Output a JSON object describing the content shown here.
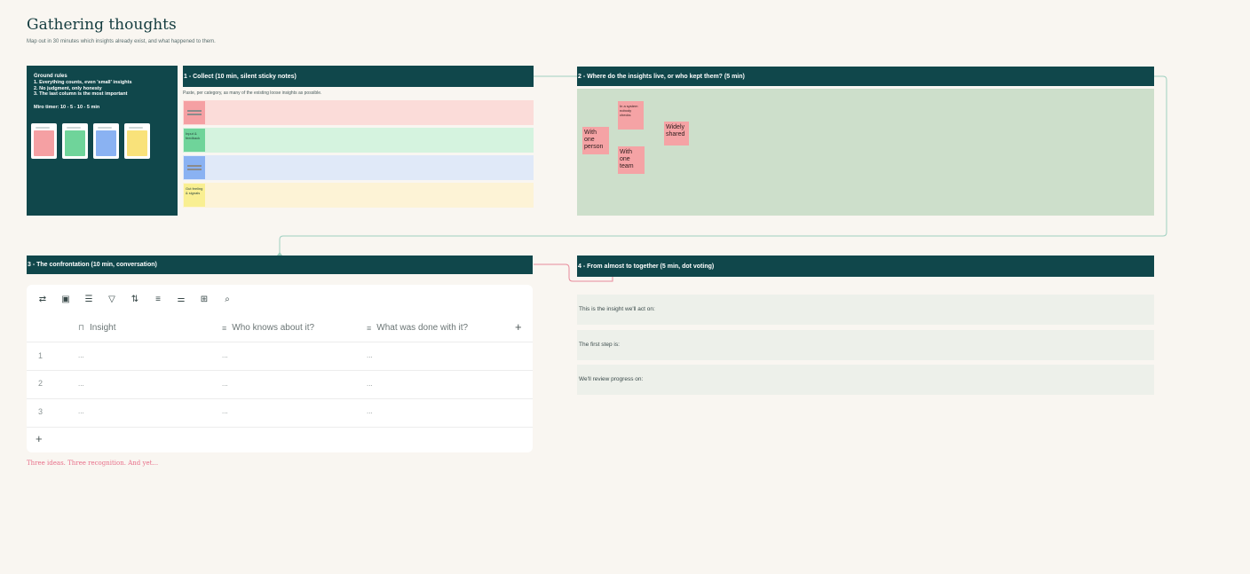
{
  "board": {
    "title": "Gathering thoughts",
    "subtitle": "Map out in 30 minutes which insights already exist, and what happened to them."
  },
  "ground_rules": {
    "title": "Ground rules",
    "rules": [
      "1. Everything counts, even 'small' insights",
      "2. No judgment, only honesty",
      "3. The last column is the most important"
    ],
    "timer": "Miro timer: 10 - 5 - 10 - 5 min",
    "swatches": [
      {
        "name": "red",
        "color": "#f5a0a3"
      },
      {
        "name": "green",
        "color": "#6fd49a"
      },
      {
        "name": "blue",
        "color": "#8ab2f2"
      },
      {
        "name": "yellow",
        "color": "#f9e27a"
      }
    ]
  },
  "collect": {
    "header": "1 - Collect (10 min, silent sticky notes)",
    "note": "Paste, per category, as many of the existing loose insights as possible.",
    "rows": [
      {
        "row_color": "#fbdcd9",
        "label_color": "#f5a0a3",
        "label": ""
      },
      {
        "row_color": "#d5f3df",
        "label_color": "#6fd49a",
        "label": "Input & feedback"
      },
      {
        "row_color": "#e0e9f8",
        "label_color": "#8ab2f2",
        "label": ""
      },
      {
        "row_color": "#fdf3d6",
        "label_color": "#f9ef92",
        "label": "Gut feeling & signals"
      }
    ]
  },
  "where": {
    "header": "2 - Where do the insights live, or who kept them? (5 min)",
    "stickies": [
      "In a system nobody checks",
      "With one person",
      "With one team",
      "Widely shared"
    ]
  },
  "confrontation": {
    "header": "3 - The confrontation (10 min, conversation)",
    "toolbar_icons": [
      "sync-icon",
      "layout-icon",
      "group-icon",
      "filter-icon",
      "sort-icon",
      "list-icon",
      "settings-icon",
      "export-icon",
      "search-icon"
    ],
    "columns": [
      "Insight",
      "Who knows about it?",
      "What was done with it?"
    ],
    "rows": [
      {
        "num": "1",
        "cells": [
          "...",
          "...",
          "..."
        ]
      },
      {
        "num": "2",
        "cells": [
          "...",
          "...",
          "..."
        ]
      },
      {
        "num": "3",
        "cells": [
          "...",
          "...",
          "..."
        ]
      }
    ],
    "add_column": "+",
    "add_row": "+",
    "caption": "Three ideas. Three recognition. And yet..."
  },
  "together": {
    "header": "4 - From almost to together (5 min, dot voting)",
    "statements": [
      "This is the insight we'll act on:",
      "The first step is:",
      "We'll review progress on:"
    ]
  },
  "colors": {
    "header_bg": "#10474b",
    "canvas_bg": "#f9f6f1",
    "connector_green": "#9ed0c0",
    "connector_red": "#e88a9a"
  }
}
